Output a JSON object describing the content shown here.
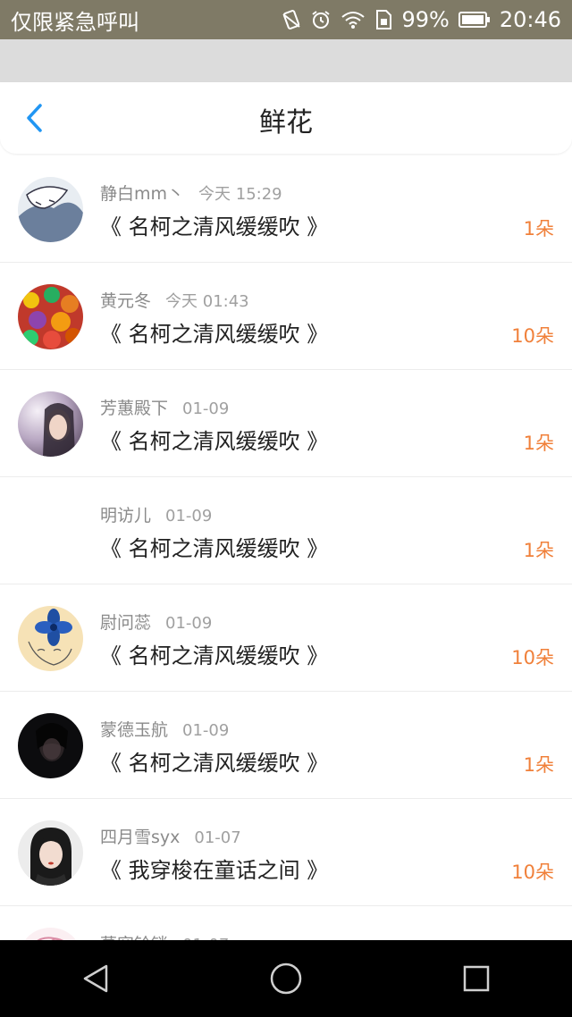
{
  "statusbar": {
    "carrier": "仅限紧急呼叫",
    "battery": "99%",
    "time": "20:46"
  },
  "header": {
    "title": "鲜花"
  },
  "items": [
    {
      "name": "静白mm丶",
      "time": "今天 15:29",
      "book": "《 名柯之清风缓缓吹 》",
      "count": "1朵",
      "avatar": "anime-sketch"
    },
    {
      "name": "黄元冬",
      "time": "今天 01:43",
      "book": "《 名柯之清风缓缓吹 》",
      "count": "10朵",
      "avatar": "candy"
    },
    {
      "name": "芳蕙殿下",
      "time": "01-09",
      "book": "《 名柯之清风缓缓吹 》",
      "count": "1朵",
      "avatar": "girl-photo"
    },
    {
      "name": "明访儿",
      "time": "01-09",
      "book": "《 名柯之清风缓缓吹 》",
      "count": "1朵",
      "avatar": "none"
    },
    {
      "name": "尉问蕊",
      "time": "01-09",
      "book": "《 名柯之清风缓缓吹 》",
      "count": "10朵",
      "avatar": "blue-flower"
    },
    {
      "name": "蒙德玉航",
      "time": "01-09",
      "book": "《 名柯之清风缓缓吹 》",
      "count": "1朵",
      "avatar": "dark-portrait"
    },
    {
      "name": "四月雪syx",
      "time": "01-07",
      "book": "《 我穿梭在童话之间 》",
      "count": "10朵",
      "avatar": "woman-portrait"
    },
    {
      "name": "慕容铃锁",
      "time": "01-07",
      "book": "",
      "count": "",
      "avatar": "pink-sketch"
    }
  ],
  "colors": {
    "accent": "#2196f3",
    "count": "#f0803a",
    "statusbar": "#7f7a66"
  }
}
